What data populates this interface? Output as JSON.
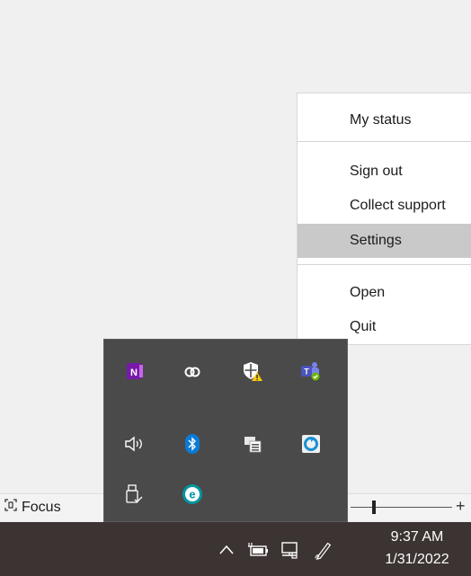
{
  "context_menu": {
    "items": [
      {
        "label": "My status"
      },
      {
        "label": "Sign out"
      },
      {
        "label": "Collect support"
      },
      {
        "label": "Settings"
      },
      {
        "label": "Open"
      },
      {
        "label": "Quit"
      }
    ],
    "highlighted": "Settings"
  },
  "status_bar": {
    "focus_label": "Focus",
    "zoom_plus": "+"
  },
  "tray_overflow": {
    "icons": [
      "onenote-icon",
      "creative-cloud-icon",
      "security-shield-warning-icon",
      "teams-icon",
      "volume-icon",
      "bluetooth-icon",
      "network-storage-icon",
      "sync-client-icon",
      "usb-drive-icon",
      "eset-icon"
    ]
  },
  "taskbar": {
    "time": "9:37 AM",
    "date": "1/31/2022"
  }
}
